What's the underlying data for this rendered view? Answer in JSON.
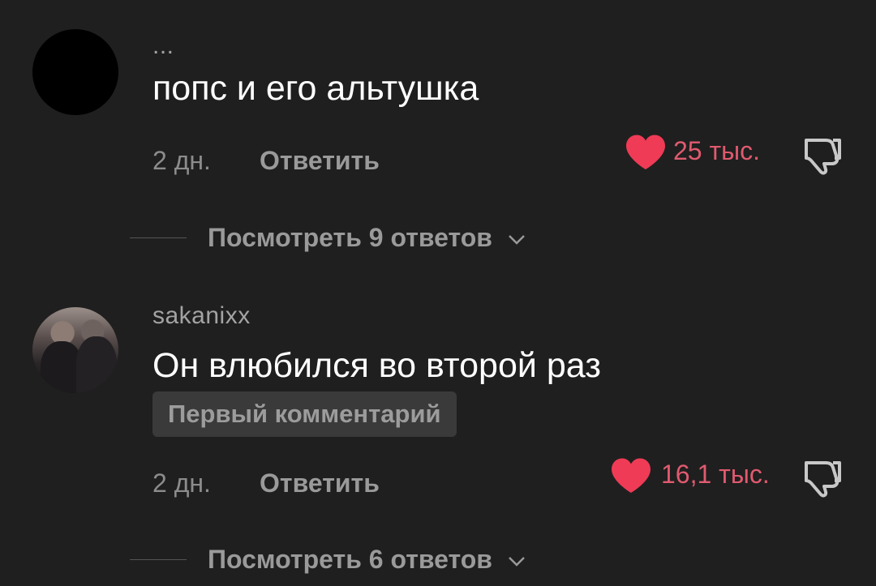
{
  "comments": [
    {
      "username": "...",
      "text": "попс и его альтушка",
      "timestamp": "2 дн.",
      "reply_label": "Ответить",
      "likes": "25 тыс.",
      "view_replies": "Посмотреть 9 ответов"
    },
    {
      "username": "sakanixx",
      "text": "Он влюбился во второй раз",
      "badge": "Первый комментарий",
      "timestamp": "2 дн.",
      "reply_label": "Ответить",
      "likes": "16,1 тыс.",
      "view_replies": "Посмотреть 6 ответов"
    }
  ],
  "icons": {
    "like": "heart-icon",
    "dislike": "thumbs-down-icon",
    "expand": "chevron-down-icon"
  },
  "colors": {
    "background": "#1f1f1f",
    "like_heart": "#ef3b56",
    "like_count": "#e05a6f",
    "muted_text": "#9a9a9a",
    "badge_bg": "#3a3a3a"
  }
}
